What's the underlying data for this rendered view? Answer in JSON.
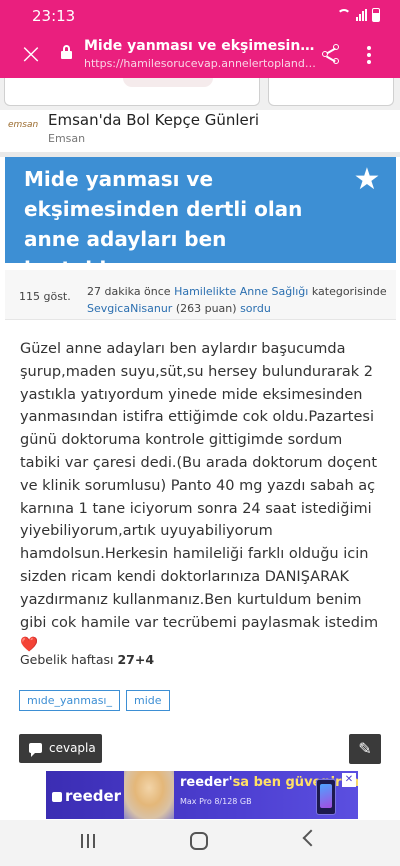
{
  "status_bar": {
    "time": "23:13"
  },
  "browser": {
    "page_title": "Mide yanması ve ekşimesinden d...",
    "url": "https://hamilesorucevap.annelertoplandik.co..."
  },
  "ad": {
    "logo_text": "emsan",
    "title": "Emsan'da Bol Kepçe Günleri",
    "advertiser": "Emsan"
  },
  "question": {
    "title": "Mide yanması ve ekşimesinden dertli olan anne adayları ben kurtuldum",
    "views": "115 göst.",
    "time_ago": "27 dakika önce",
    "category": "Hamilelikte Anne Sağlığı",
    "category_suffix": "kategorisinde",
    "author": "SevgicaNisanur",
    "author_points": "(263 puan)",
    "action": "sordu",
    "body": "Güzel anne adayları ben aylardır başucumda şurup,maden suyu,süt,su hersey bulundurarak 2 yastıkla yatıyordum yinede mide eksimesinden yanmasından istifra ettiğimde cok oldu.Pazartesi günü doktoruma kontrole gittigimde sordum tabiki var çaresi dedi.(Bu arada doktorum doçent ve klinik sorumlusu) Panto 40 mg yazdı sabah aç karnına 1 tane iciyorum sonra 24 saat istediğimi yiyebiliyorum,artık uyuyabiliyorum hamdolsun.Herkesin hamileliği farklı olduğu icin sizden ricam kendi doktorlarınıza DANIŞARAK yazdırmanız kullanmanız.Ben kurtuldum benim gibi cok hamile var tecrübemi paylasmak istedim❤️",
    "week_label": "Gebelik haftası",
    "week_value": "27+4",
    "tags": [
      "mıde_yanması_",
      "mide"
    ],
    "reply_label": "cevapla"
  },
  "banner_ad": {
    "brand": "reeder",
    "headline_prefix": "reeder'",
    "headline_highlight": "sa ben güvenirim",
    "subline": "Max Pro 8/128 GB",
    "close": "✕"
  },
  "colors": {
    "browser_bar": "#ea1f7e",
    "question_header": "#3d8fd4",
    "link": "#2b6fb0",
    "button_dark": "#3a3a3a"
  }
}
